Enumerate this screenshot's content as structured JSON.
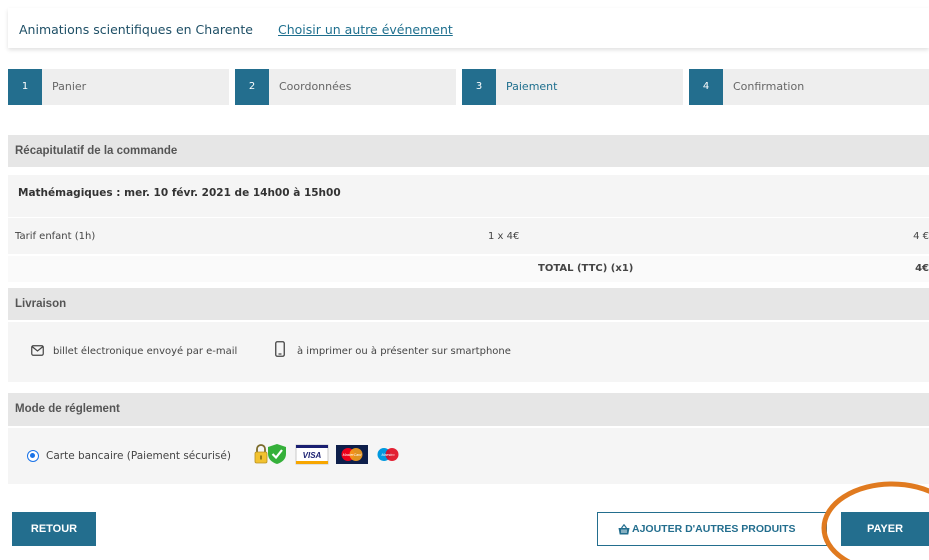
{
  "header": {
    "title": "Animations scientifiques en Charente",
    "change_event_link": "Choisir un autre événement"
  },
  "steps": [
    {
      "number": "1",
      "label": "Panier"
    },
    {
      "number": "2",
      "label": "Coordonnées"
    },
    {
      "number": "3",
      "label": "Paiement",
      "active": true
    },
    {
      "number": "4",
      "label": "Confirmation"
    }
  ],
  "summary": {
    "heading": "Récapitulatif de la commande",
    "event": "Mathémagiques : mer. 10 févr. 2021 de 14h00 à 15h00",
    "line": {
      "tariff": "Tarif enfant (1h)",
      "quantity_price": "1 x 4€",
      "amount": "4 €"
    },
    "total_label": "TOTAL (TTC) (x1)",
    "total_value": "4€"
  },
  "delivery": {
    "heading": "Livraison",
    "email_option": "billet électronique envoyé par e-mail",
    "smartphone_option": "à imprimer ou à présenter sur smartphone"
  },
  "payment": {
    "heading": "Mode de réglement",
    "method_label": "Carte bancaire (Paiement sécurisé)",
    "card_logos": {
      "visa": "VISA",
      "mastercard": "MasterCard",
      "maestro": "Maestro"
    }
  },
  "buttons": {
    "back": "RETOUR",
    "add_products": "AJOUTER D'AUTRES PRODUITS",
    "pay": "PAYER"
  },
  "colors": {
    "primary": "#236e8e",
    "highlight_circle": "#e07a1f"
  }
}
